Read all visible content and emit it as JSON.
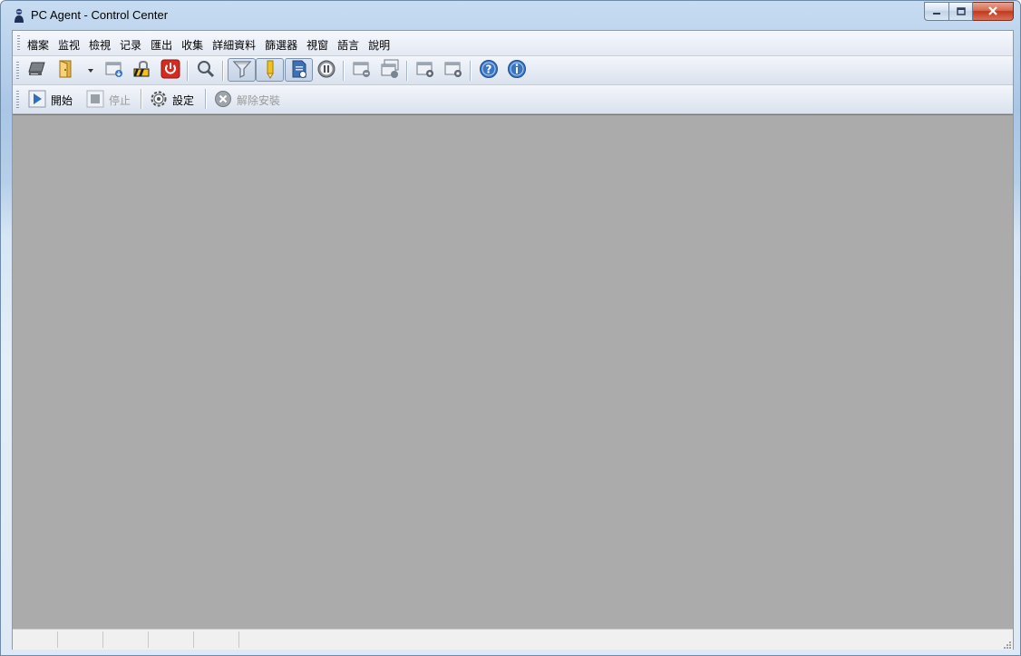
{
  "window": {
    "title": "PC Agent - Control Center",
    "controls": {
      "minimize": "minimize",
      "maximize": "maximize",
      "close": "close"
    }
  },
  "menubar": {
    "items": [
      {
        "label": "檔案"
      },
      {
        "label": "监视"
      },
      {
        "label": "檢視"
      },
      {
        "label": "记录"
      },
      {
        "label": "匯出"
      },
      {
        "label": "收集"
      },
      {
        "label": "詳細資料"
      },
      {
        "label": "篩選器"
      },
      {
        "label": "視窗"
      },
      {
        "label": "語言"
      },
      {
        "label": "說明"
      }
    ]
  },
  "toolbar": {
    "icons": [
      "computer-icon",
      "door-icon",
      "dropdown-arrow-icon",
      "window-download-icon",
      "lock-warning-icon",
      "power-icon",
      "search-icon",
      "filter-icon",
      "pencil-icon",
      "document-icon",
      "pause-icon",
      "window-minus-icon",
      "windows-stack-icon",
      "window-camera-icon",
      "window-record-icon",
      "help-icon",
      "info-icon"
    ]
  },
  "toolbar2": {
    "start_label": "開始",
    "stop_label": "停止",
    "settings_label": "設定",
    "uninstall_label": "解除安裝"
  },
  "colors": {
    "content_bg": "#ababab",
    "accent": "#3a75c4",
    "power_red": "#d42a1f"
  }
}
